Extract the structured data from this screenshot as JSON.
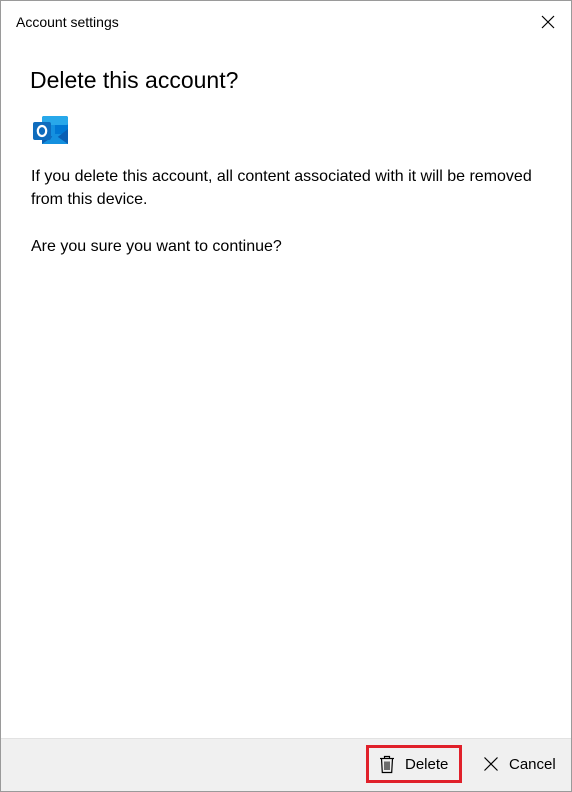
{
  "window": {
    "title": "Account settings"
  },
  "dialog": {
    "heading": "Delete this account?",
    "app_icon": "outlook-icon",
    "message": "If you delete this account, all content associated with it will be removed from this device.",
    "confirm": "Are you sure you want to continue?"
  },
  "buttons": {
    "delete_label": "Delete",
    "delete_icon": "trash-icon",
    "cancel_label": "Cancel",
    "cancel_icon": "x-icon"
  },
  "colors": {
    "highlight": "#e0202a",
    "outlook_blue": "#0f6cbd",
    "footer_bg": "#f0f0f0"
  }
}
